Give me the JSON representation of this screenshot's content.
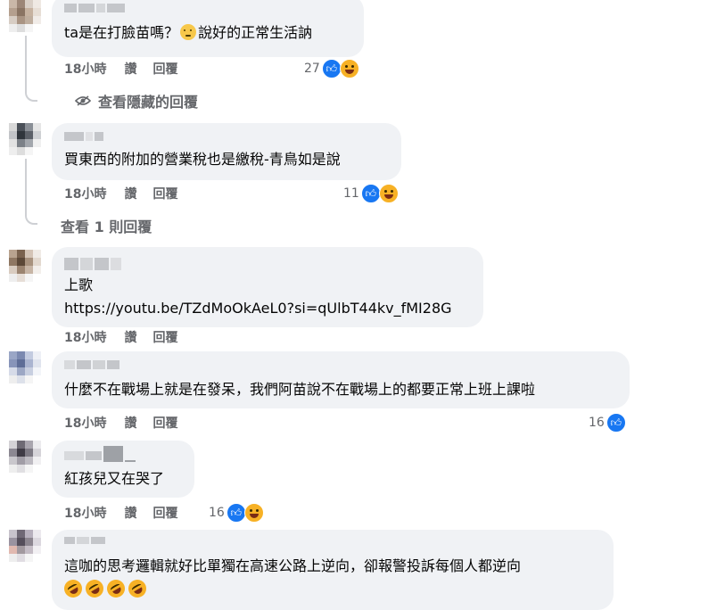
{
  "comments": [
    {
      "text": "ta是在打臉苗嗎？",
      "text_after": "說好的正常生活訥",
      "inline_emoji": "slightly-frowning-face",
      "time": "18小時",
      "like": "讚",
      "reply": "回覆",
      "count": "27",
      "reactions": [
        "like",
        "haha"
      ]
    },
    {
      "text": "買東西的附加的營業稅也是繳稅-青鳥如是說",
      "time": "18小時",
      "like": "讚",
      "reply": "回覆",
      "count": "11",
      "reactions": [
        "like",
        "haha"
      ]
    },
    {
      "text": "上歌",
      "link": "https://youtu.be/TZdMoOkAeL0?si=qUlbT44kv_fMI28G",
      "time": "18小時",
      "like": "讚",
      "reply": "回覆"
    },
    {
      "text": "什麼不在戰場上就是在發呆，我們阿苗說不在戰場上的都要正常上班上課啦",
      "time": "18小時",
      "like": "讚",
      "reply": "回覆",
      "count": "16",
      "reactions": [
        "like"
      ]
    },
    {
      "text": "紅孩兒又在哭了",
      "time": "18小時",
      "like": "讚",
      "reply": "回覆",
      "count": "16",
      "reactions": [
        "like",
        "haha"
      ]
    },
    {
      "text": "這咖的思考邏輯就好比單獨在高速公路上逆向，卻報警投訴每個人都逆向",
      "emoji_row": [
        "rofl",
        "rofl",
        "rofl",
        "rofl"
      ]
    }
  ],
  "view_hidden": "查看隱藏的回覆",
  "view_one_reply": "查看 1 則回覆",
  "colors": {
    "bubble": "#f0f2f5",
    "meta": "#65676b",
    "like": "#1877f2",
    "haha": "#f7b125"
  }
}
